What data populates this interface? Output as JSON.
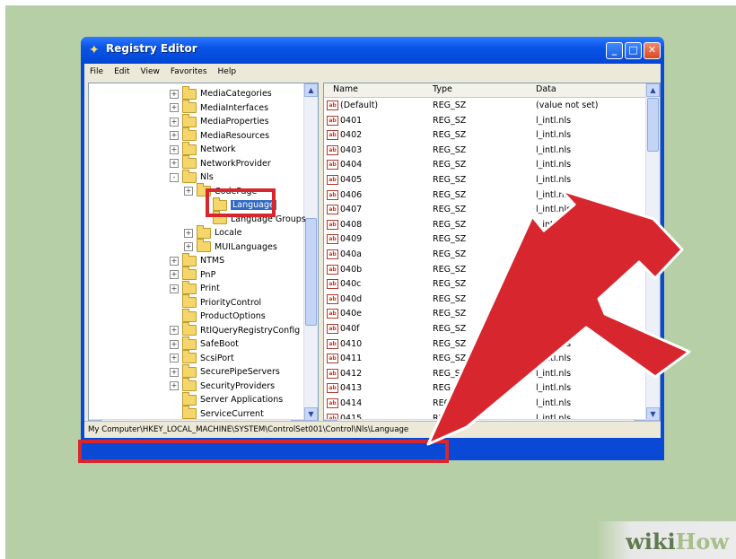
{
  "window": {
    "title": "Registry Editor",
    "icon": "registry-editor-icon",
    "controls": [
      "_",
      "□",
      "✕"
    ]
  },
  "menu": [
    "File",
    "Edit",
    "View",
    "Favorites",
    "Help"
  ],
  "tree": {
    "items": [
      {
        "label": "MediaCategories",
        "expander": "+"
      },
      {
        "label": "MediaInterfaces",
        "expander": "+"
      },
      {
        "label": "MediaProperties",
        "expander": "+"
      },
      {
        "label": "MediaResources",
        "expander": "+"
      },
      {
        "label": "Network",
        "expander": "+"
      },
      {
        "label": "NetworkProvider",
        "expander": "+"
      },
      {
        "label": "Nls",
        "expander": "-"
      },
      {
        "label": "CodePage",
        "expander": "+"
      },
      {
        "label": "Language",
        "expander": ""
      },
      {
        "label": "Language Groups",
        "expander": ""
      },
      {
        "label": "Locale",
        "expander": "+"
      },
      {
        "label": "MUILanguages",
        "expander": "+"
      },
      {
        "label": "NTMS",
        "expander": "+"
      },
      {
        "label": "PnP",
        "expander": "+"
      },
      {
        "label": "Print",
        "expander": "+"
      },
      {
        "label": "PriorityControl",
        "expander": ""
      },
      {
        "label": "ProductOptions",
        "expander": ""
      },
      {
        "label": "RtlQueryRegistryConfig",
        "expander": "+"
      },
      {
        "label": "SafeBoot",
        "expander": "+"
      },
      {
        "label": "ScsiPort",
        "expander": "+"
      },
      {
        "label": "SecurePipeServers",
        "expander": "+"
      },
      {
        "label": "SecurityProviders",
        "expander": "+"
      },
      {
        "label": "Server Applications",
        "expander": ""
      },
      {
        "label": "ServiceCurrent",
        "expander": ""
      }
    ]
  },
  "list": {
    "columns": [
      "Name",
      "Type",
      "Data"
    ],
    "rows": [
      {
        "name": "(Default)",
        "type": "REG_SZ",
        "data": "(value not set)"
      },
      {
        "name": "0401",
        "type": "REG_SZ",
        "data": "l_intl.nls"
      },
      {
        "name": "0402",
        "type": "REG_SZ",
        "data": "l_intl.nls"
      },
      {
        "name": "0403",
        "type": "REG_SZ",
        "data": "l_intl.nls"
      },
      {
        "name": "0404",
        "type": "REG_SZ",
        "data": "l_intl.nls"
      },
      {
        "name": "0405",
        "type": "REG_SZ",
        "data": "l_intl.nls"
      },
      {
        "name": "0406",
        "type": "REG_SZ",
        "data": "l_intl.nls"
      },
      {
        "name": "0407",
        "type": "REG_SZ",
        "data": "l_intl.nls"
      },
      {
        "name": "0408",
        "type": "REG_SZ",
        "data": "l_intl.nls"
      },
      {
        "name": "0409",
        "type": "REG_SZ",
        "data": "l_intl.nls"
      },
      {
        "name": "040a",
        "type": "REG_SZ",
        "data": "l_intl.nls"
      },
      {
        "name": "040b",
        "type": "REG_SZ",
        "data": "l_intl.nls"
      },
      {
        "name": "040c",
        "type": "REG_SZ",
        "data": "l_intl.nls"
      },
      {
        "name": "040d",
        "type": "REG_SZ",
        "data": "l_intl.nls"
      },
      {
        "name": "040e",
        "type": "REG_SZ",
        "data": "l_intl.nls"
      },
      {
        "name": "040f",
        "type": "REG_SZ",
        "data": "l_intl.nls"
      },
      {
        "name": "0410",
        "type": "REG_SZ",
        "data": "l_intl.nls"
      },
      {
        "name": "0411",
        "type": "REG_SZ",
        "data": "l_intl.nls"
      },
      {
        "name": "0412",
        "type": "REG_SZ",
        "data": "l_intl.nls"
      },
      {
        "name": "0413",
        "type": "REG_SZ",
        "data": "l_intl.nls"
      },
      {
        "name": "0414",
        "type": "REG_SZ",
        "data": "l_intl.nls"
      },
      {
        "name": "0415",
        "type": "REG_SZ",
        "data": "l_intl.nls"
      }
    ]
  },
  "status": {
    "path": "My Computer\\HKEY_LOCAL_MACHINE\\SYSTEM\\ControlSet001\\Control\\Nls\\Language"
  },
  "watermark": {
    "part1": "wiki",
    "part2": "How"
  },
  "colors": {
    "highlight": "#d8262f",
    "background": "#b7cfa6",
    "titlebar": "#0a54e6"
  }
}
